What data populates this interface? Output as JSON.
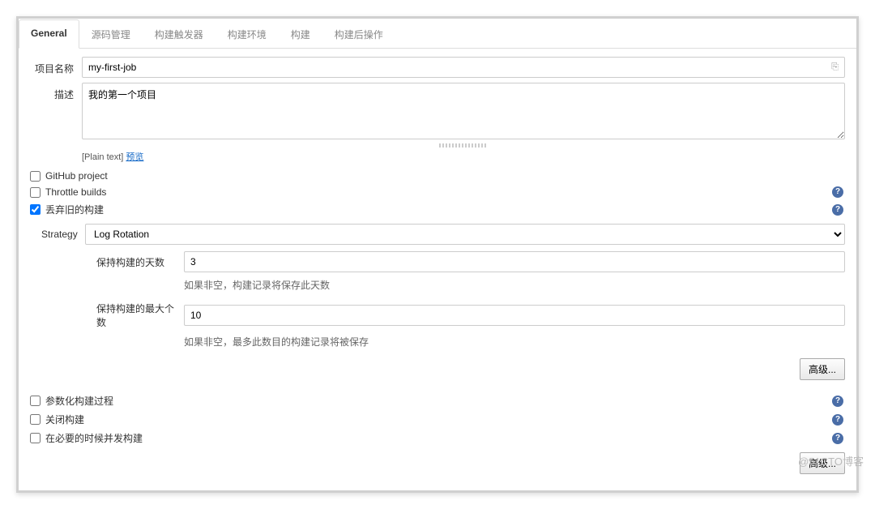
{
  "tabs": {
    "general": "General",
    "scm": "源码管理",
    "triggers": "构建触发器",
    "env": "构建环境",
    "build": "构建",
    "post": "构建后操作"
  },
  "labels": {
    "project_name": "项目名称",
    "description": "描述",
    "plain_text_prefix": "[Plain text] ",
    "preview": "预览",
    "strategy": "Strategy",
    "days_keep": "保持构建的天数",
    "days_keep_desc": "如果非空，构建记录将保存此天数",
    "max_keep": "保持构建的最大个数",
    "max_keep_desc": "如果非空，最多此数目的构建记录将被保存",
    "advanced": "高级..."
  },
  "values": {
    "project_name": "my-first-job",
    "description": "我的第一个项目",
    "strategy_selected": "Log Rotation",
    "days_keep": "3",
    "max_keep": "10"
  },
  "checks": {
    "github_project": {
      "label": "GitHub project",
      "checked": false,
      "has_help": false
    },
    "throttle_builds": {
      "label": "Throttle builds",
      "checked": false,
      "has_help": true
    },
    "discard_old": {
      "label": "丢弃旧的构建",
      "checked": true,
      "has_help": true
    },
    "param_build": {
      "label": "参数化构建过程",
      "checked": false,
      "has_help": true
    },
    "disable_build": {
      "label": "关闭构建",
      "checked": false,
      "has_help": true
    },
    "concurrent_build": {
      "label": "在必要的时候并发构建",
      "checked": false,
      "has_help": true
    }
  },
  "icons": {
    "hint": "⎘"
  },
  "watermark": "@51CTO博客"
}
